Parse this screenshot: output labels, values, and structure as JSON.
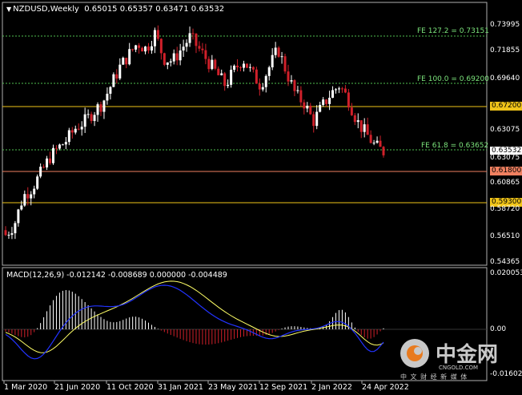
{
  "header": {
    "symbol": "NZDUSD,Weekly",
    "ohlc": "0.65015 0.65357 0.63471 0.63532"
  },
  "macd": {
    "label": "MACD(12,26,9) -0.012142 -0.008689 0.000000 -0.004489"
  },
  "price_axis": {
    "ticks": [
      "0.73995",
      "0.71855",
      "0.69640",
      "0.63075",
      "0.60865",
      "0.58720",
      "0.56510",
      "0.54365"
    ],
    "current_price": "0.63532"
  },
  "levels": {
    "fe1272": "FE 127.2 = 0.73151",
    "fe100": "FE 100.0 = 0.69200",
    "fe618": "FE 61.8 = 0.63652",
    "l6720": "0.67200",
    "l6180": "0.61800",
    "l5930": "0.59300"
  },
  "macd_axis": {
    "top": "0.020053",
    "mid": "0.00",
    "bottom": "-0.016028"
  },
  "time_axis": [
    "1 Mar 2020",
    "21 Jun 2020",
    "11 Oct 2020",
    "31 Jan 2021",
    "23 May 2021",
    "12 Sep 2021",
    "2 Jan 2022",
    "24 Apr 2022"
  ],
  "watermark": {
    "title": "中金网",
    "subtitle": "中 文 财 经 新 媒 体",
    "site": "CNGOLD.COM"
  },
  "colors": {
    "bull": "#ffffff",
    "bear": "#d0202a",
    "fe_line": "#4fbf4f",
    "level_yellow": "#f0c419",
    "level_red": "#f08060",
    "macd_signal": "#ffff66",
    "macd_main": "#2233ff"
  },
  "chart_data": {
    "type": "candlestick",
    "close_series_approx": [
      0.566,
      0.575,
      0.598,
      0.605,
      0.617,
      0.63,
      0.638,
      0.645,
      0.655,
      0.66,
      0.668,
      0.675,
      0.69,
      0.705,
      0.715,
      0.725,
      0.72,
      0.733,
      0.712,
      0.71,
      0.72,
      0.73,
      0.72,
      0.71,
      0.7,
      0.69,
      0.702,
      0.712,
      0.7,
      0.69,
      0.705,
      0.72,
      0.7,
      0.682,
      0.675,
      0.66,
      0.672,
      0.683,
      0.69,
      0.678,
      0.66,
      0.65,
      0.64,
      0.635
    ]
  }
}
